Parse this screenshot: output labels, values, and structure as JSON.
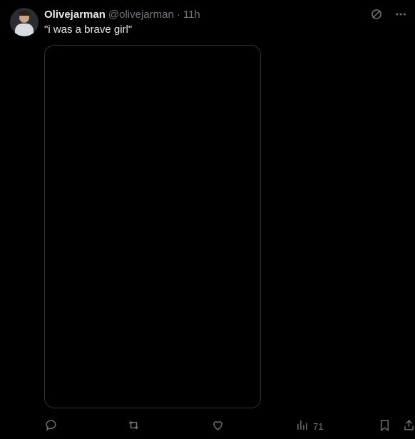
{
  "tweet": {
    "author_name": "Olivejarman",
    "handle": "@olivejarman",
    "separator": "·",
    "time": "11h",
    "text": "\"i was a brave girl\""
  },
  "media": {
    "type": "image"
  },
  "actions": {
    "reply_count": "",
    "retweet_count": "",
    "like_count": "",
    "views_count": "71"
  },
  "icons": {
    "grok": "grok-icon",
    "more": "more-icon",
    "reply": "reply-icon",
    "retweet": "retweet-icon",
    "like": "like-icon",
    "views": "views-icon",
    "bookmark": "bookmark-icon",
    "share": "share-icon"
  },
  "colors": {
    "background": "#000000",
    "text": "#e7e9ea",
    "muted": "#71767b",
    "border": "#2f3336"
  }
}
